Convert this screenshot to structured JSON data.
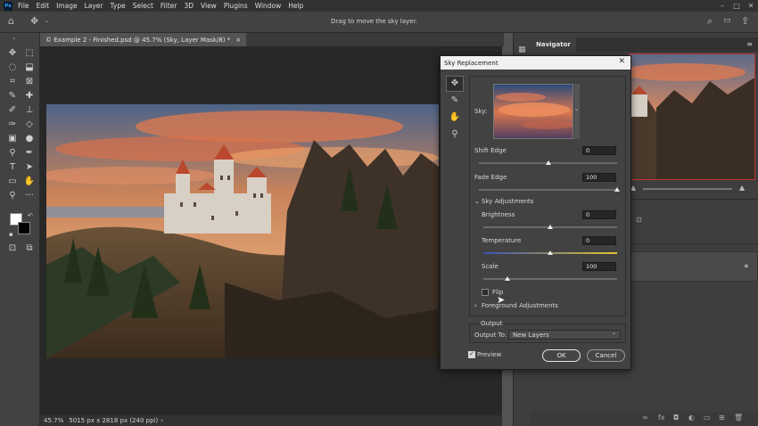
{
  "menu": {
    "logo": "Ps",
    "items": [
      "File",
      "Edit",
      "Image",
      "Layer",
      "Type",
      "Select",
      "Filter",
      "3D",
      "View",
      "Plugins",
      "Window",
      "Help"
    ]
  },
  "options_bar": {
    "hint": "Drag to move the sky layer."
  },
  "document": {
    "tab_title": "© Example 2 - Finished.psd @ 45.7% (Sky, Layer Mask/8) *",
    "tab_close": "×",
    "status_zoom": "45.7%",
    "status_info": "5015 px x 2818 px (240 ppi)"
  },
  "panels": {
    "navigator_tab": "Navigator"
  },
  "dialog": {
    "title": "Sky Replacement",
    "close": "✕",
    "sky_label": "Sky:",
    "shift_edge": {
      "label": "Shift Edge",
      "value": "0",
      "level": 0.5
    },
    "fade_edge": {
      "label": "Fade Edge",
      "value": "100",
      "level": 1.0
    },
    "sky_adjustments": "Sky Adjustments",
    "brightness": {
      "label": "Brightness",
      "value": "0",
      "level": 0.5
    },
    "temperature": {
      "label": "Temperature",
      "value": "0",
      "level": 0.5
    },
    "scale": {
      "label": "Scale",
      "value": "100",
      "level": 0.18
    },
    "flip_label": "Flip",
    "foreground_adjustments": "Foreground Adjustments",
    "output_section": "Output",
    "output_to_label": "Output To:",
    "output_to_value": "New Layers",
    "preview_label": "Preview",
    "ok": "OK",
    "cancel": "Cancel"
  },
  "colors": {
    "accent": "#31a8ff",
    "nav_frame": "#c5322d"
  }
}
